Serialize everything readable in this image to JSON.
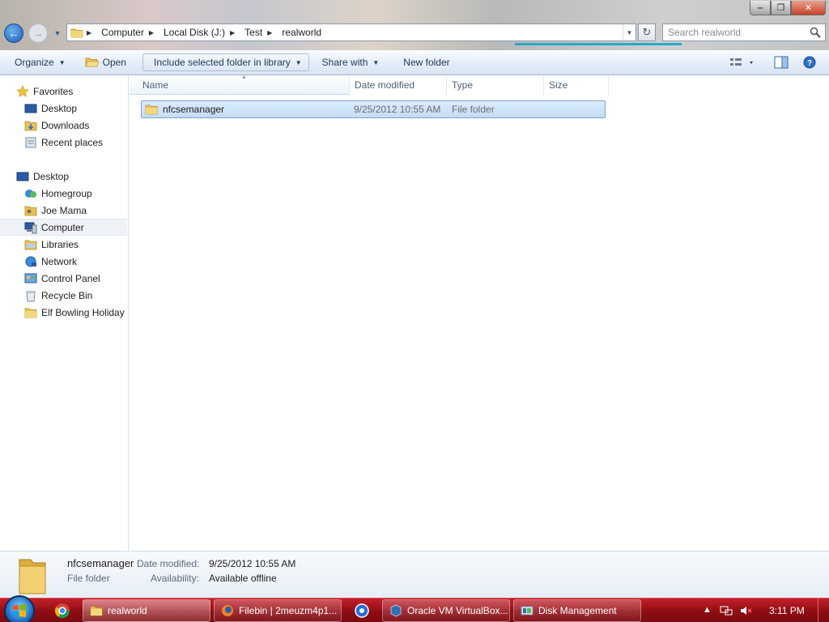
{
  "window": {
    "controls": {
      "minimize": "‒",
      "maximize": "❐",
      "close": "✕"
    }
  },
  "nav": {
    "back_icon": "back-arrow-icon",
    "forward_icon": "forward-arrow-icon",
    "breadcrumbs": [
      "Computer",
      "Local Disk (J:)",
      "Test",
      "realworld"
    ]
  },
  "search": {
    "placeholder": "Search realworld"
  },
  "toolbar": {
    "organize": "Organize",
    "open": "Open",
    "include": "Include selected folder in library",
    "share": "Share with",
    "new_folder": "New folder"
  },
  "sidebar": {
    "favorites_header": "Favorites",
    "favorites": [
      "Desktop",
      "Downloads",
      "Recent places"
    ],
    "desktop_header": "Desktop",
    "desktop_items": [
      "Homegroup",
      "Joe Mama",
      "Computer",
      "Libraries",
      "Network",
      "Control Panel",
      "Recycle Bin",
      "Elf Bowling Holiday"
    ],
    "selected": "Computer"
  },
  "columns": {
    "name": "Name",
    "date": "Date modified",
    "type": "Type",
    "size": "Size"
  },
  "files": [
    {
      "name": "nfcsemanager",
      "date": "9/25/2012 10:55 AM",
      "type": "File folder",
      "size": ""
    }
  ],
  "details": {
    "name": "nfcsemanager",
    "kind": "File folder",
    "date_label": "Date modified:",
    "date_value": "9/25/2012 10:55 AM",
    "avail_label": "Availability:",
    "avail_value": "Available offline"
  },
  "taskbar": {
    "buttons": [
      "realworld",
      "Filebin | 2meuzm4p1...",
      "Oracle VM VirtualBox...",
      "Disk Management"
    ],
    "clock": "3:11 PM"
  },
  "colors": {
    "accent": "#1d5cb4",
    "taskbar": "#a3131b",
    "selection": "#cde3f8"
  }
}
